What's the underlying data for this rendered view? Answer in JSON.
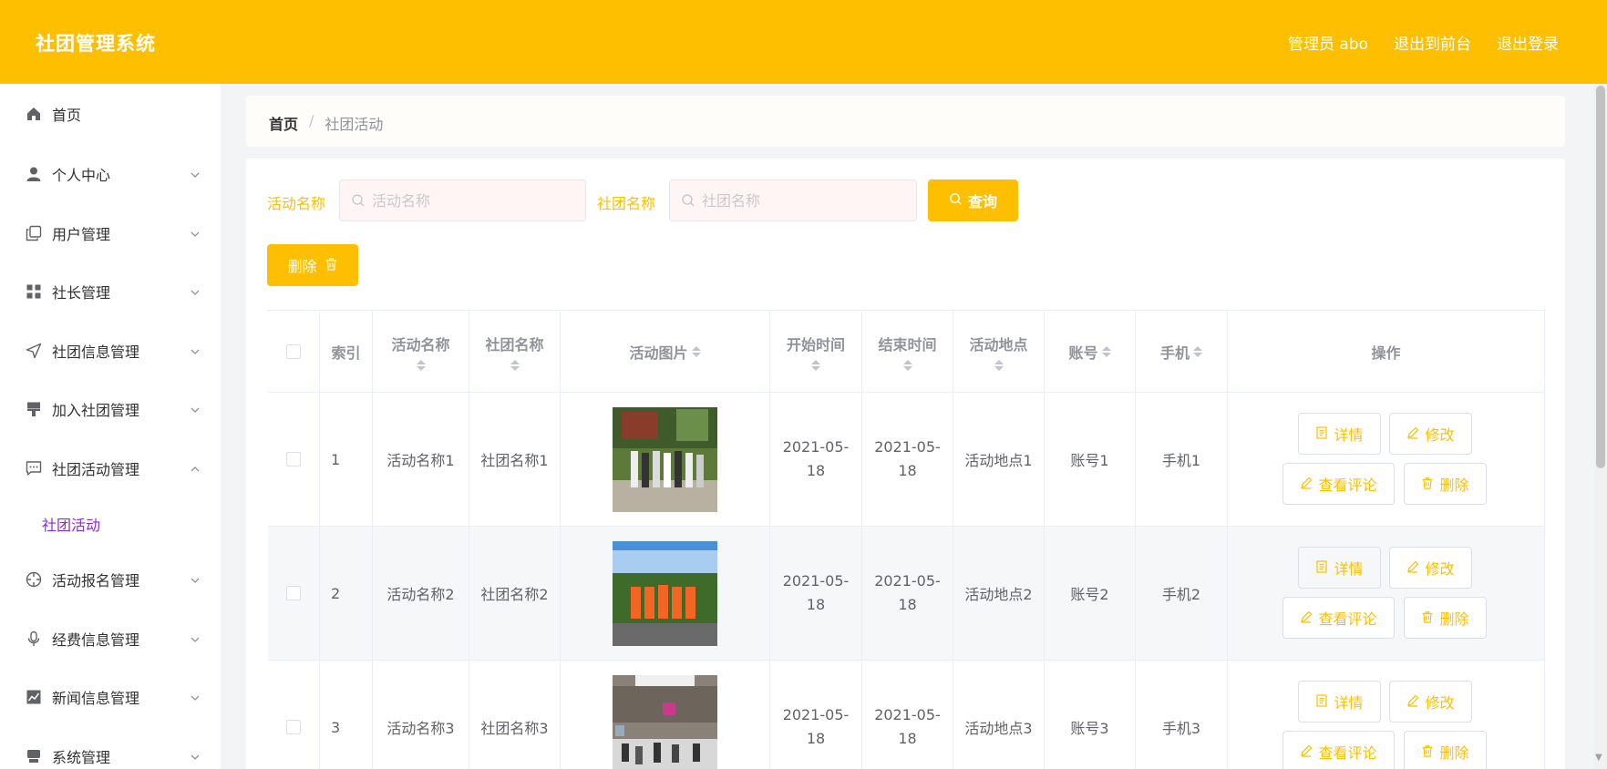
{
  "header": {
    "title": "社团管理系统",
    "admin": "管理员 abo",
    "back_front": "退出到前台",
    "logout": "退出登录",
    "color": "#fdbf00"
  },
  "sidebar": {
    "items": [
      {
        "label": "首页",
        "icon": "home-icon"
      },
      {
        "label": "个人中心",
        "icon": "user-icon"
      },
      {
        "label": "用户管理",
        "icon": "copy-icon"
      },
      {
        "label": "社长管理",
        "icon": "grid-icon"
      },
      {
        "label": "社团信息管理",
        "icon": "send-icon"
      },
      {
        "label": "加入社团管理",
        "icon": "brush-icon"
      },
      {
        "label": "社团活动管理",
        "icon": "chat-icon"
      },
      {
        "label": "活动报名管理",
        "icon": "crosshair-icon"
      },
      {
        "label": "经费信息管理",
        "icon": "microphone-icon"
      },
      {
        "label": "新闻信息管理",
        "icon": "chart-icon"
      },
      {
        "label": "系统管理",
        "icon": "printer-icon"
      }
    ],
    "sub_active": "社团活动"
  },
  "breadcrumb": {
    "home": "首页",
    "sep": "/",
    "current": "社团活动"
  },
  "search": {
    "activity_label": "活动名称",
    "activity_placeholder": "活动名称",
    "club_label": "社团名称",
    "club_placeholder": "社团名称",
    "query_button": "查询"
  },
  "toolbar": {
    "delete_button": "删除"
  },
  "table": {
    "headers": {
      "index": "索引",
      "activity_name": "活动名称",
      "club_name": "社团名称",
      "image": "活动图片",
      "start": "开始时间",
      "end": "结束时间",
      "place": "活动地点",
      "account": "账号",
      "phone": "手机",
      "ops": "操作"
    },
    "rows": [
      {
        "index": "1",
        "activity_name": "活动名称1",
        "club_name": "社团名称1",
        "start": "2021-05-18",
        "end": "2021-05-18",
        "place": "活动地点1",
        "account": "账号1",
        "phone": "手机1"
      },
      {
        "index": "2",
        "activity_name": "活动名称2",
        "club_name": "社团名称2",
        "start": "2021-05-18",
        "end": "2021-05-18",
        "place": "活动地点2",
        "account": "账号2",
        "phone": "手机2"
      },
      {
        "index": "3",
        "activity_name": "活动名称3",
        "club_name": "社团名称3",
        "start": "2021-05-18",
        "end": "2021-05-18",
        "place": "活动地点3",
        "account": "账号3",
        "phone": "手机3"
      }
    ],
    "ops": {
      "detail": "详情",
      "edit": "修改",
      "comments": "查看评论",
      "delete": "删除"
    }
  }
}
